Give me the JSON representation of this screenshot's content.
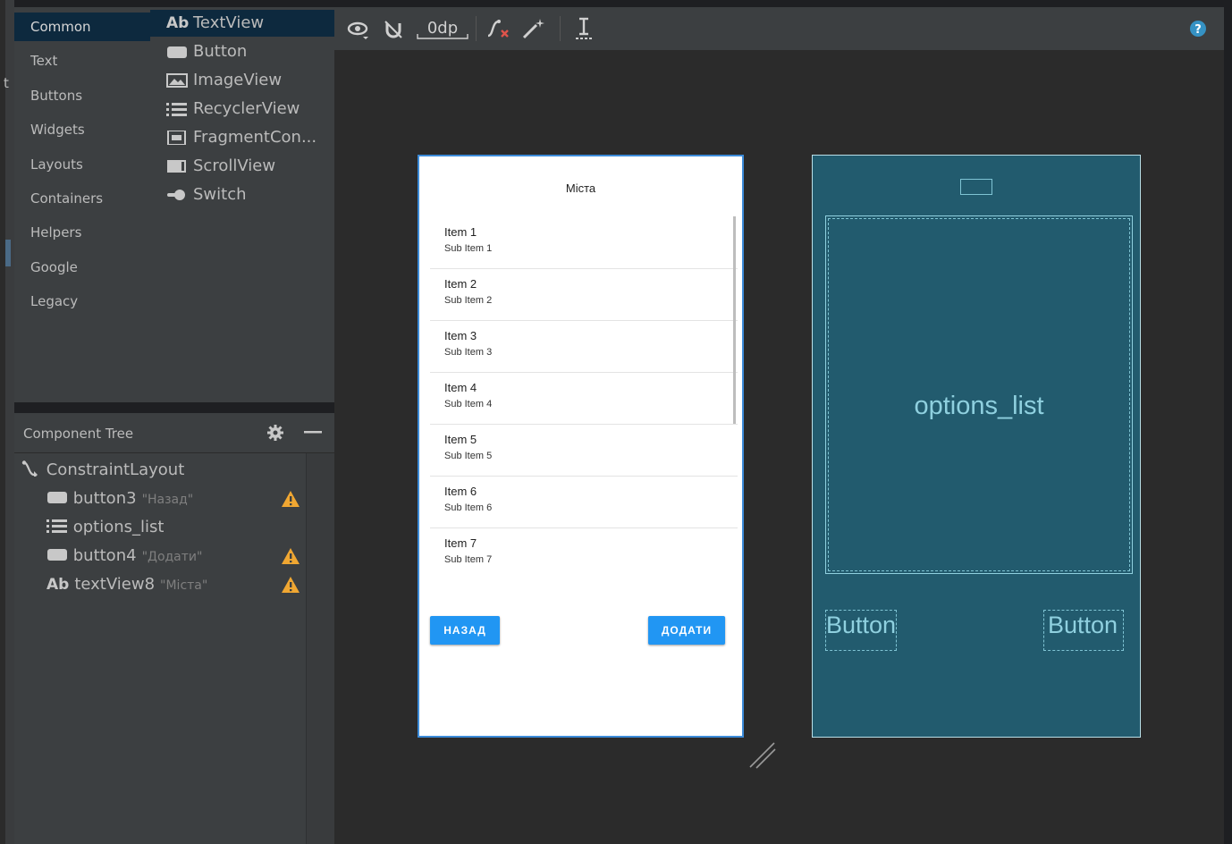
{
  "gutter": {
    "fragment_text": "t"
  },
  "palette": {
    "categories": [
      "Common",
      "Text",
      "Buttons",
      "Widgets",
      "Layouts",
      "Containers",
      "Helpers",
      "Google",
      "Legacy"
    ],
    "selected_category": "Common",
    "items": [
      {
        "label": "TextView",
        "icon": "textview-icon"
      },
      {
        "label": "Button",
        "icon": "button-icon"
      },
      {
        "label": "ImageView",
        "icon": "imageview-icon"
      },
      {
        "label": "RecyclerView",
        "icon": "recyclerview-icon"
      },
      {
        "label": "FragmentCon...",
        "icon": "fragment-container-icon"
      },
      {
        "label": "ScrollView",
        "icon": "scrollview-icon"
      },
      {
        "label": "Switch",
        "icon": "switch-icon"
      }
    ],
    "textview_prefix": "Ab"
  },
  "component_tree": {
    "title": "Component Tree",
    "root": "ConstraintLayout",
    "rows": [
      {
        "id": "button3",
        "text": "\"Назад\"",
        "warning": true
      },
      {
        "id": "options_list",
        "text": "",
        "warning": false
      },
      {
        "id": "button4",
        "text": "\"Додати\"",
        "warning": true
      },
      {
        "id": "textView8",
        "text": "\"Міста\"",
        "warning": true
      }
    ],
    "textview_prefix": "Ab"
  },
  "toolbar": {
    "margin_value": "0dp",
    "warning_color": "#f0a732",
    "accent": "#3592c4"
  },
  "phone": {
    "title": "Міста",
    "items": [
      {
        "title": "Item 1",
        "sub": "Sub Item 1"
      },
      {
        "title": "Item 2",
        "sub": "Sub Item 2"
      },
      {
        "title": "Item 3",
        "sub": "Sub Item 3"
      },
      {
        "title": "Item 4",
        "sub": "Sub Item 4"
      },
      {
        "title": "Item 5",
        "sub": "Sub Item 5"
      },
      {
        "title": "Item 6",
        "sub": "Sub Item 6"
      },
      {
        "title": "Item 7",
        "sub": "Sub Item 7"
      }
    ],
    "back_button": "НАЗАД",
    "add_button": "ДОДАТИ",
    "button_color": "#2196f3"
  },
  "blueprint": {
    "list_label": "options_list",
    "left_button": "Button",
    "right_button": "Button",
    "background": "#225b6e"
  }
}
